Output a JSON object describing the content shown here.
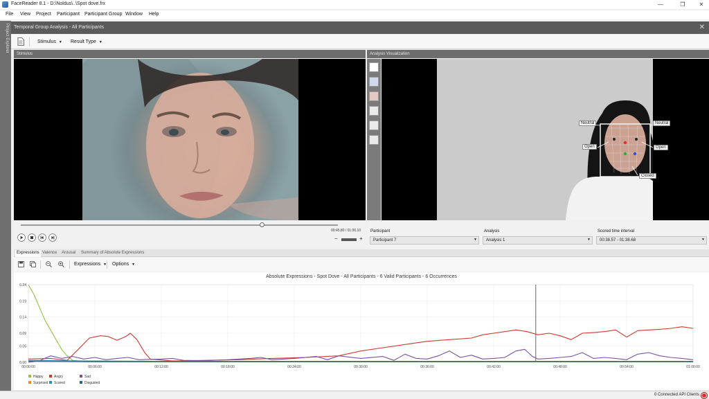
{
  "window": {
    "title": "FaceReader 8.1 - D:\\Noldus\\..\\Spot dove.frx",
    "controls": {
      "minimize": "—",
      "restore": "❐",
      "close": "✕"
    }
  },
  "menu": [
    "File",
    "View",
    "Project",
    "Participant",
    "Participant Group",
    "Window",
    "Help"
  ],
  "left_strip": {
    "label": "Project Explorer"
  },
  "panel": {
    "title": "Temporal Group Analysis - All Participants",
    "close": "✕"
  },
  "toolbar": {
    "stimulus": "Stimulus",
    "result_type": "Result Type"
  },
  "stimulus": {
    "header": "Stimulus",
    "time": "00:45.80 / 01:00.10",
    "progress": 0.76,
    "minus": "−",
    "plus": "+"
  },
  "analysis": {
    "header": "Analysis Visualization",
    "face_labels": {
      "neutral_left": "Neutral",
      "neutral_right": "Neutral",
      "open_left": "Open",
      "open_right": "Open",
      "closed": "Closed"
    },
    "participant_label": "Participant",
    "participant_value": "Participant 7",
    "analysis_label": "Analysis",
    "analysis_value": "Analysis 1",
    "interval_label": "Scored time interval",
    "interval_value": "00:38.57 - 01:38.68"
  },
  "bottom_tabs": [
    {
      "label": "Expressions",
      "active": true
    },
    {
      "label": "Valence",
      "active": false
    },
    {
      "label": "Arousal",
      "active": false
    },
    {
      "label": "Summary of Absolute Expressions",
      "active": false
    }
  ],
  "bottom_toolbar": {
    "expressions": "Expressions",
    "options": "Options"
  },
  "status": {
    "text": "0 Connected API Clients"
  },
  "chart_data": {
    "type": "line",
    "title": "Absolute Expressions - Spot Dove - All Participants - 6 Valid Participants - 6 Occurrences",
    "y_ticks": [
      "0.24",
      "0.19",
      "0.14",
      "0.09",
      "0.05",
      "0.00"
    ],
    "y_tick_values": [
      0.24,
      0.19,
      0.14,
      0.09,
      0.05,
      0.0
    ],
    "ylim": [
      0,
      0.24
    ],
    "x_ticks": [
      "00:00:00",
      "00:06:00",
      "00:12:00",
      "00:18:00",
      "00:24:00",
      "00:30:00",
      "00:36:00",
      "00:42:00",
      "00:48:00",
      "00:54:00",
      "01:00:00"
    ],
    "xlim_seconds": [
      0,
      60
    ],
    "cursor_seconds": 45.8,
    "grid": true,
    "legend_position": "bottom-left",
    "series": [
      {
        "name": "Happy",
        "color": "#8dc63f",
        "points": [
          [
            0,
            0.24
          ],
          [
            0.5,
            0.21
          ],
          [
            1,
            0.17
          ],
          [
            1.5,
            0.13
          ],
          [
            2,
            0.1
          ],
          [
            2.5,
            0.07
          ],
          [
            3,
            0.04
          ],
          [
            3.5,
            0.02
          ],
          [
            4,
            0.006
          ],
          [
            5,
            0.002
          ],
          [
            6,
            0.001
          ],
          [
            60,
            0.001
          ]
        ]
      },
      {
        "name": "Angry",
        "color": "#d2362d",
        "points": [
          [
            0,
            0.01
          ],
          [
            2,
            0.012
          ],
          [
            3.5,
            0.006
          ],
          [
            4.5,
            0.04
          ],
          [
            5.5,
            0.075
          ],
          [
            6.5,
            0.082
          ],
          [
            7.2,
            0.08
          ],
          [
            8,
            0.068
          ],
          [
            8.8,
            0.08
          ],
          [
            9.2,
            0.09
          ],
          [
            9.8,
            0.07
          ],
          [
            10.5,
            0.03
          ],
          [
            11,
            0.01
          ],
          [
            13,
            0.004
          ],
          [
            16,
            0.006
          ],
          [
            19,
            0.008
          ],
          [
            22,
            0.012
          ],
          [
            25,
            0.015
          ],
          [
            28,
            0.02
          ],
          [
            30,
            0.035
          ],
          [
            32,
            0.045
          ],
          [
            34,
            0.055
          ],
          [
            36,
            0.065
          ],
          [
            38,
            0.07
          ],
          [
            40,
            0.075
          ],
          [
            41,
            0.085
          ],
          [
            42,
            0.09
          ],
          [
            43,
            0.095
          ],
          [
            44,
            0.1
          ],
          [
            45,
            0.095
          ],
          [
            46,
            0.085
          ],
          [
            47,
            0.09
          ],
          [
            48,
            0.082
          ],
          [
            49,
            0.07
          ],
          [
            50,
            0.09
          ],
          [
            51,
            0.092
          ],
          [
            52,
            0.095
          ],
          [
            53,
            0.1
          ],
          [
            54,
            0.078
          ],
          [
            55,
            0.098
          ],
          [
            56,
            0.1
          ],
          [
            57,
            0.102
          ],
          [
            58,
            0.105
          ],
          [
            59,
            0.11
          ],
          [
            60,
            0.105
          ]
        ]
      },
      {
        "name": "Sad",
        "color": "#7b4fa3",
        "points": [
          [
            0,
            0.0
          ],
          [
            1,
            0.005
          ],
          [
            2,
            0.02
          ],
          [
            3,
            0.012
          ],
          [
            4,
            0.018
          ],
          [
            5,
            0.01
          ],
          [
            6,
            0.015
          ],
          [
            7,
            0.008
          ],
          [
            8,
            0.012
          ],
          [
            9,
            0.015
          ],
          [
            10,
            0.008
          ],
          [
            12,
            0.01
          ],
          [
            13,
            0.012
          ],
          [
            14,
            0.006
          ],
          [
            16,
            0.005
          ],
          [
            18,
            0.008
          ],
          [
            20,
            0.012
          ],
          [
            21,
            0.015
          ],
          [
            22,
            0.008
          ],
          [
            24,
            0.012
          ],
          [
            26,
            0.018
          ],
          [
            27,
            0.008
          ],
          [
            28,
            0.02
          ],
          [
            30,
            0.012
          ],
          [
            32,
            0.018
          ],
          [
            33,
            0.006
          ],
          [
            34,
            0.025
          ],
          [
            35,
            0.012
          ],
          [
            36,
            0.01
          ],
          [
            37,
            0.02
          ],
          [
            38,
            0.035
          ],
          [
            39,
            0.015
          ],
          [
            40,
            0.022
          ],
          [
            41,
            0.01
          ],
          [
            42,
            0.012
          ],
          [
            43,
            0.015
          ],
          [
            44,
            0.035
          ],
          [
            44.8,
            0.04
          ],
          [
            45.5,
            0.018
          ],
          [
            46,
            0.01
          ],
          [
            47,
            0.012
          ],
          [
            48,
            0.015
          ],
          [
            49,
            0.018
          ],
          [
            50,
            0.03
          ],
          [
            51,
            0.012
          ],
          [
            52,
            0.015
          ],
          [
            53,
            0.012
          ],
          [
            54,
            0.008
          ],
          [
            55,
            0.025
          ],
          [
            56,
            0.03
          ],
          [
            57,
            0.02
          ],
          [
            58,
            0.015
          ],
          [
            59,
            0.012
          ],
          [
            60,
            0.008
          ]
        ]
      },
      {
        "name": "Surprised",
        "color": "#f08c24",
        "points": [
          [
            0,
            0.004
          ],
          [
            6,
            0.003
          ],
          [
            12,
            0.002
          ],
          [
            24,
            0.002
          ],
          [
            36,
            0.002
          ],
          [
            48,
            0.002
          ],
          [
            60,
            0.002
          ]
        ]
      },
      {
        "name": "Scared",
        "color": "#2a8fb0",
        "points": [
          [
            0,
            0.006
          ],
          [
            6,
            0.004
          ],
          [
            12,
            0.003
          ],
          [
            24,
            0.003
          ],
          [
            36,
            0.003
          ],
          [
            48,
            0.003
          ],
          [
            60,
            0.003
          ]
        ]
      },
      {
        "name": "Disgusted",
        "color": "#2c5a9a",
        "points": [
          [
            0,
            0.003
          ],
          [
            6,
            0.002
          ],
          [
            12,
            0.002
          ],
          [
            24,
            0.002
          ],
          [
            36,
            0.002
          ],
          [
            48,
            0.002
          ],
          [
            60,
            0.002
          ]
        ]
      }
    ]
  }
}
